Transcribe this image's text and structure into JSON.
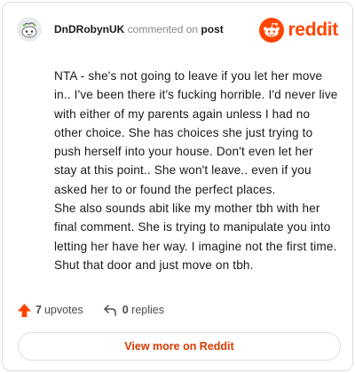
{
  "header": {
    "username": "DnDRobynUK",
    "action": "commented on",
    "target": "post",
    "brand": "reddit"
  },
  "comment": {
    "paragraphs": [
      "NTA - she's not going to leave if you let her move in.. I've been there it's fucking horrible. I'd never live with either of my parents again unless I had no other choice. She has choices she just trying to push herself into your house. Don't even let her stay at this point.. She won't leave.. even if you asked her to or found the perfect places.",
      "She also sounds abit like my mother tbh with her final comment. She is trying to manipulate you into letting her have her way. I imagine not the first time. Shut that door and just move on tbh."
    ]
  },
  "footer": {
    "upvote_count": "7",
    "upvote_label": "upvotes",
    "reply_count": "0",
    "reply_label": "replies"
  },
  "cta": {
    "label": "View more on Reddit"
  },
  "colors": {
    "brand": "#ff4500",
    "cta_text": "#d93a00",
    "text": "#1a1a1b",
    "muted": "#878a8c",
    "border": "#dcdfe3"
  },
  "icons": {
    "avatar": "snoo-avatar-icon",
    "logo": "reddit-logo-icon",
    "upvote": "upvote-arrow-icon",
    "reply": "reply-arrow-icon"
  }
}
